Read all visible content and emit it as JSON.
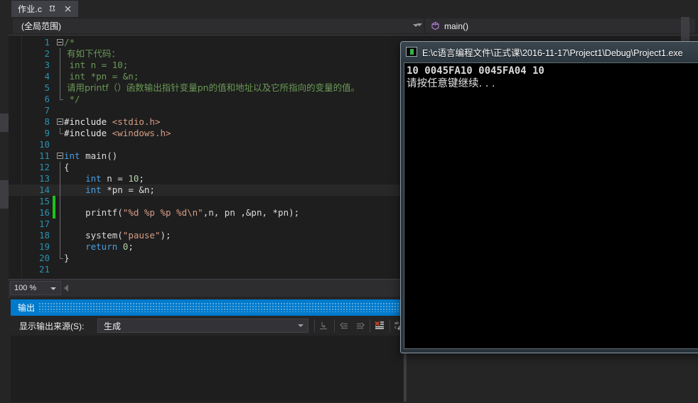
{
  "tab": {
    "title": "作业.c",
    "pin_icon": "pin-icon",
    "close_icon": "close-icon"
  },
  "navbar": {
    "scope": "(全局范围)",
    "member": "main()",
    "member_icon": "method-icon"
  },
  "editor": {
    "zoom_level": "100 %",
    "lines": [
      {
        "n": "1",
        "glyph": "collapse",
        "vline": "",
        "chg": "",
        "cur": false,
        "segments": [
          {
            "t": "/*",
            "c": "cn"
          }
        ]
      },
      {
        "n": "2",
        "glyph": "",
        "vline": "mid",
        "chg": "",
        "cur": false,
        "segments": [
          {
            "t": " 有如下代码：",
            "c": "cn-cjk"
          }
        ]
      },
      {
        "n": "3",
        "glyph": "",
        "vline": "mid",
        "chg": "",
        "cur": false,
        "segments": [
          {
            "t": " int n = 10;",
            "c": "cn"
          }
        ]
      },
      {
        "n": "4",
        "glyph": "",
        "vline": "mid",
        "chg": "",
        "cur": false,
        "segments": [
          {
            "t": " int *pn = &n;",
            "c": "cn"
          }
        ]
      },
      {
        "n": "5",
        "glyph": "",
        "vline": "mid",
        "chg": "",
        "cur": false,
        "segments": [
          {
            "t": " 请用printf（）函数输出指针变量pn的值和地址以及它所指向的变量的值。",
            "c": "cn-cjk"
          }
        ]
      },
      {
        "n": "6",
        "glyph": "",
        "vline": "end",
        "chg": "",
        "cur": false,
        "segments": [
          {
            "t": " */",
            "c": "cn"
          }
        ]
      },
      {
        "n": "7",
        "glyph": "",
        "vline": "",
        "chg": "",
        "cur": false,
        "segments": []
      },
      {
        "n": "8",
        "glyph": "collapse",
        "vline": "",
        "chg": "",
        "cur": false,
        "segments": [
          {
            "t": "#include ",
            "c": "pp"
          },
          {
            "t": "<stdio.h>",
            "c": "inc"
          }
        ]
      },
      {
        "n": "9",
        "glyph": "",
        "vline": "end",
        "chg": "",
        "cur": false,
        "segments": [
          {
            "t": "#include ",
            "c": "pp"
          },
          {
            "t": "<windows.h>",
            "c": "inc"
          }
        ]
      },
      {
        "n": "10",
        "glyph": "",
        "vline": "",
        "chg": "",
        "cur": false,
        "segments": []
      },
      {
        "n": "11",
        "glyph": "collapse",
        "vline": "",
        "chg": "",
        "cur": false,
        "segments": [
          {
            "t": "int",
            "c": "kw"
          },
          {
            "t": " main()",
            "c": "pl"
          }
        ]
      },
      {
        "n": "12",
        "glyph": "",
        "vline": "mid",
        "chg": "",
        "cur": false,
        "segments": [
          {
            "t": "{",
            "c": "pl"
          }
        ]
      },
      {
        "n": "13",
        "glyph": "",
        "vline": "mid",
        "chg": "",
        "cur": false,
        "segments": [
          {
            "t": "    ",
            "c": "pl"
          },
          {
            "t": "int",
            "c": "kw"
          },
          {
            "t": " n = ",
            "c": "pl"
          },
          {
            "t": "10",
            "c": "num"
          },
          {
            "t": ";",
            "c": "pl"
          }
        ]
      },
      {
        "n": "14",
        "glyph": "",
        "vline": "mid",
        "chg": "",
        "cur": true,
        "segments": [
          {
            "t": "    ",
            "c": "pl"
          },
          {
            "t": "int",
            "c": "kw"
          },
          {
            "t": " *pn = &n;",
            "c": "pl"
          }
        ]
      },
      {
        "n": "15",
        "glyph": "",
        "vline": "mid",
        "chg": "green",
        "cur": false,
        "segments": []
      },
      {
        "n": "16",
        "glyph": "",
        "vline": "mid",
        "chg": "green",
        "cur": false,
        "segments": [
          {
            "t": "    printf(",
            "c": "pl"
          },
          {
            "t": "\"%d %p %p %d\\n\"",
            "c": "str"
          },
          {
            "t": ",n, pn ,&pn, *pn);",
            "c": "pl"
          }
        ]
      },
      {
        "n": "17",
        "glyph": "",
        "vline": "mid",
        "chg": "",
        "cur": false,
        "segments": []
      },
      {
        "n": "18",
        "glyph": "",
        "vline": "mid",
        "chg": "",
        "cur": false,
        "segments": [
          {
            "t": "    system(",
            "c": "pl"
          },
          {
            "t": "\"pause\"",
            "c": "str"
          },
          {
            "t": ");",
            "c": "pl"
          }
        ]
      },
      {
        "n": "19",
        "glyph": "",
        "vline": "mid",
        "chg": "",
        "cur": false,
        "segments": [
          {
            "t": "    ",
            "c": "pl"
          },
          {
            "t": "return",
            "c": "kw"
          },
          {
            "t": " ",
            "c": "pl"
          },
          {
            "t": "0",
            "c": "num"
          },
          {
            "t": ";",
            "c": "pl"
          }
        ]
      },
      {
        "n": "20",
        "glyph": "",
        "vline": "end",
        "chg": "",
        "cur": false,
        "segments": [
          {
            "t": "}",
            "c": "pl"
          }
        ]
      },
      {
        "n": "21",
        "glyph": "",
        "vline": "",
        "chg": "",
        "cur": false,
        "segments": []
      }
    ]
  },
  "output_panel": {
    "title": "输出",
    "source_label": "显示输出来源(S):",
    "source_value": "生成",
    "toolbar_icons": [
      "find-message-icon",
      "go-to-previous-message-icon",
      "go-to-next-message-icon",
      "clear-all-icon",
      "toggle-word-wrap-icon"
    ],
    "body_text": ""
  },
  "console_window": {
    "title": "E:\\c语言编程文件\\正式课\\2016-11-17\\Project1\\Debug\\Project1.exe",
    "icon": "console-app-icon",
    "lines": [
      "10 0045FA10 0045FA04 10",
      "请按任意键继续. . ."
    ]
  },
  "colors": {
    "accent_blue": "#007acc",
    "editor_bg": "#1e1e1e",
    "chrome_bg": "#252526",
    "keyword": "#4a9ee0",
    "comment": "#6a9955",
    "string": "#d69d85",
    "number": "#b5cea8",
    "line_number": "#2b91af",
    "change_marker_green": "#1fc21f"
  }
}
